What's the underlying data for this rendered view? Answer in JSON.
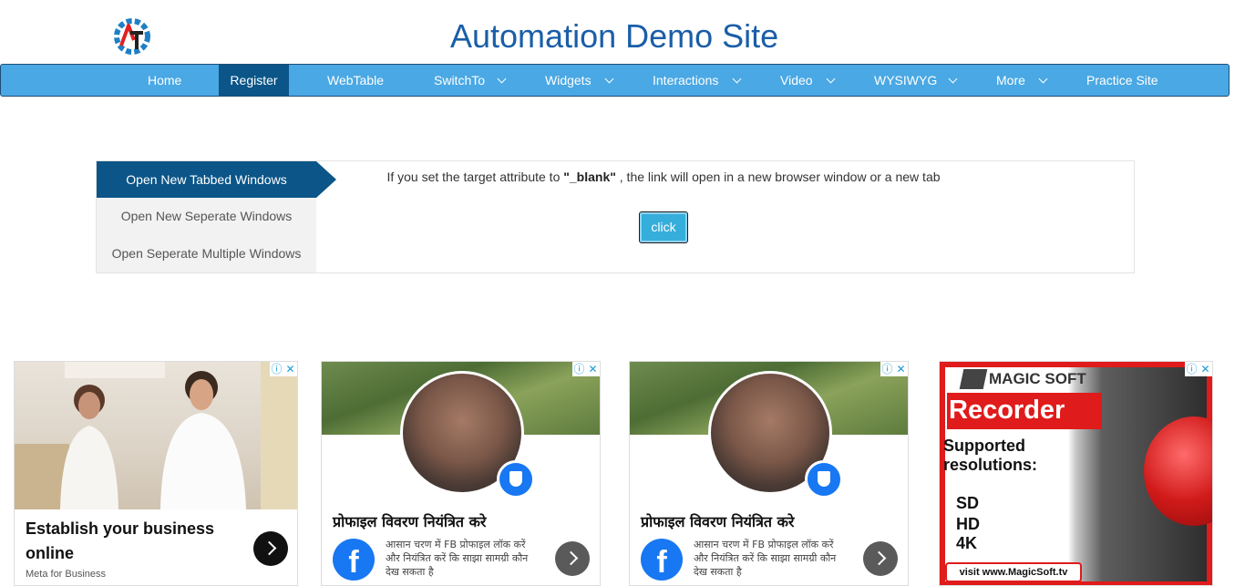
{
  "header": {
    "title": "Automation Demo Site",
    "logo_icon": "gear-at-logo-icon"
  },
  "nav": {
    "items": [
      {
        "label": "Home",
        "dropdown": false
      },
      {
        "label": "Register",
        "dropdown": false,
        "active": true
      },
      {
        "label": "WebTable",
        "dropdown": false
      },
      {
        "label": "SwitchTo",
        "dropdown": true
      },
      {
        "label": "Widgets",
        "dropdown": true
      },
      {
        "label": "Interactions",
        "dropdown": true
      },
      {
        "label": "Video",
        "dropdown": true
      },
      {
        "label": "WYSIWYG",
        "dropdown": true
      },
      {
        "label": "More",
        "dropdown": true
      },
      {
        "label": "Practice Site",
        "dropdown": false
      }
    ]
  },
  "windows": {
    "tabs": [
      {
        "label": "Open New Tabbed Windows",
        "active": true
      },
      {
        "label": "Open New Seperate Windows",
        "active": false
      },
      {
        "label": "Open Seperate Multiple Windows",
        "active": false
      }
    ],
    "description_before": "If you set the target attribute to ",
    "description_code": "\"_blank\"",
    "description_after": " , the link will open in a new browser window or a new tab",
    "button_label": "click"
  },
  "ads": {
    "ad1": {
      "title": "Establish your business online",
      "sponsor": "Meta for Business"
    },
    "ad2": {
      "title": "प्रोफाइल विवरण नियंत्रित करे",
      "text": "आसान चरण में FB प्रोफाइल लॉक करें और नियंत्रित करें कि साझा सामग्री कौन देख सकता है",
      "logo_letter": "f"
    },
    "ad3": {
      "title": "प्रोफाइल विवरण नियंत्रित करे",
      "text": "आसान चरण में FB प्रोफाइल लॉक करें और नियंत्रित करें कि साझा सामग्री कौन देख सकता है",
      "logo_letter": "f"
    },
    "ad4": {
      "brand": "MAGIC SOFT",
      "headline": "Recorder",
      "supported": "Supported resolutions:",
      "resolutions": [
        "SD",
        "HD",
        "4K"
      ],
      "visit": "visit www.MagicSoft.tv"
    },
    "info_icon": "ⓘ",
    "close_icon": "✕"
  },
  "colors": {
    "nav_bg": "#4aa8e4",
    "nav_active": "#0b5588",
    "title": "#1a5ea8",
    "button": "#36aedb"
  }
}
